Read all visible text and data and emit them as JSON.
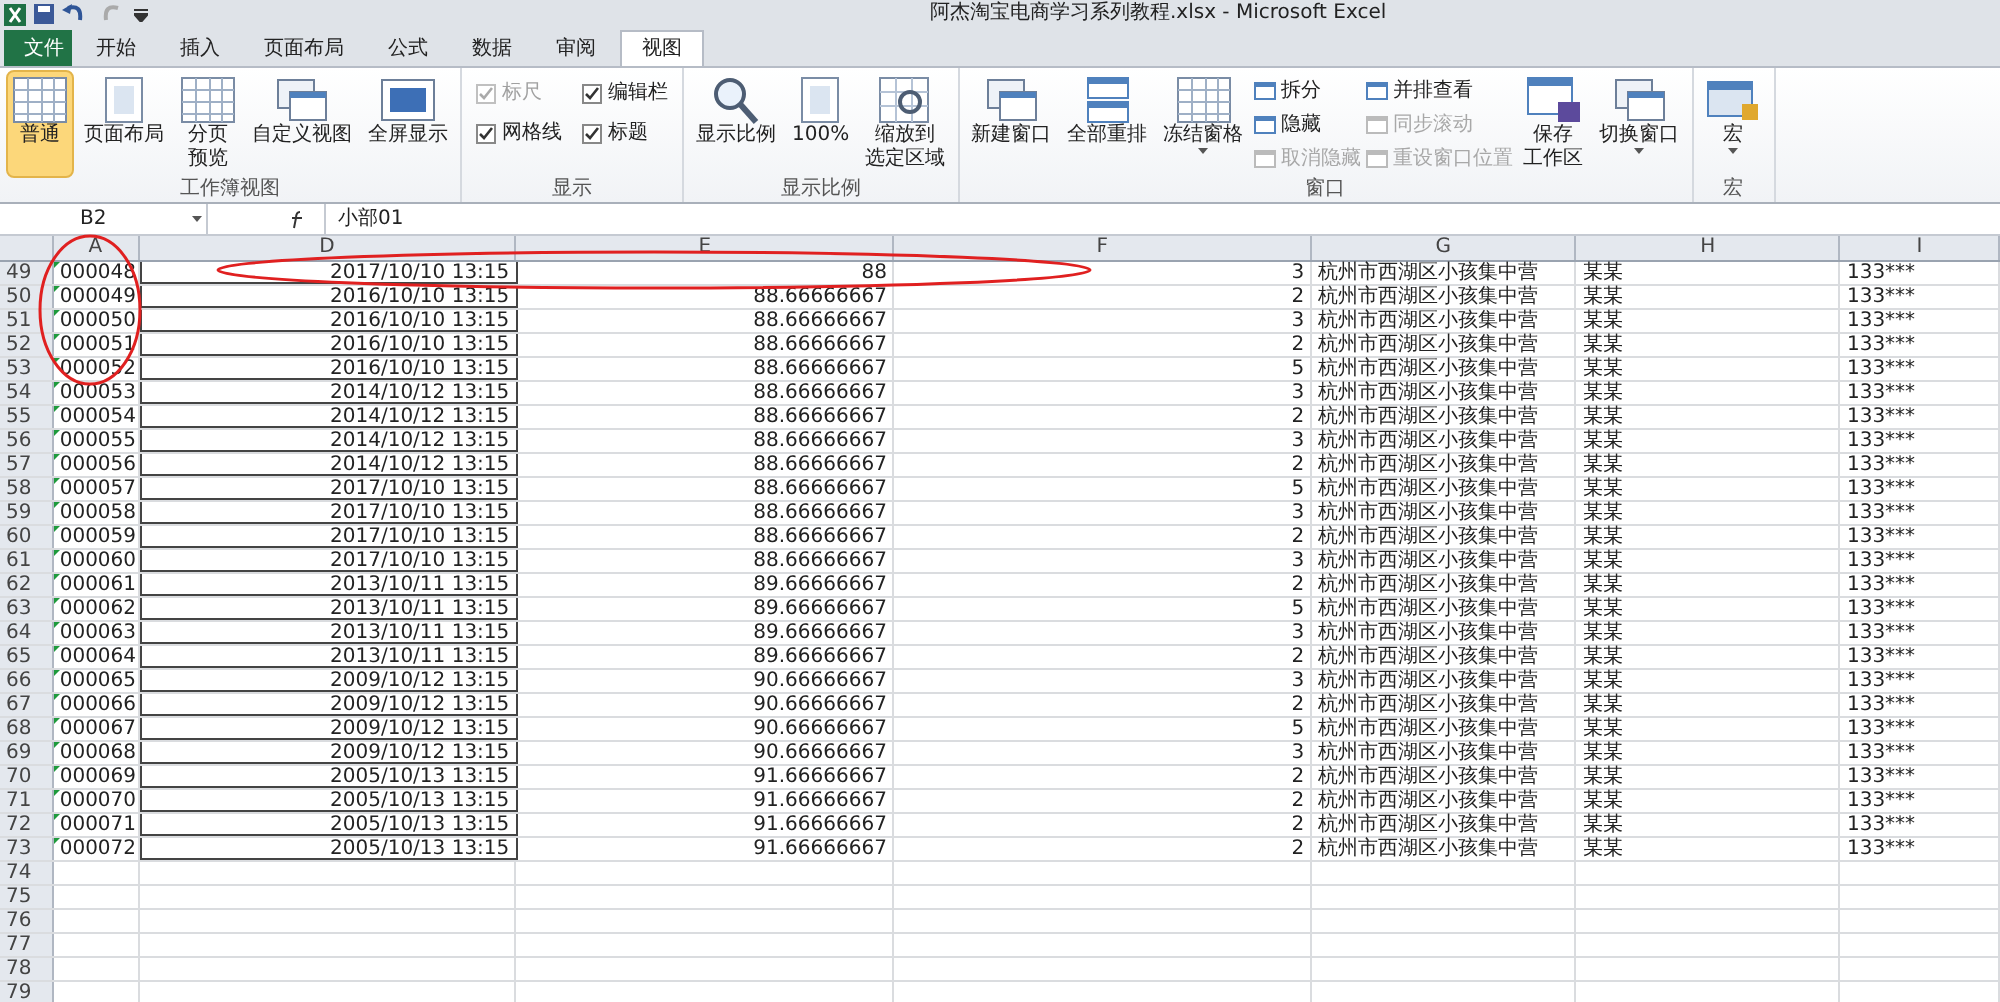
{
  "window": {
    "title": "阿杰淘宝电商学习系列教程.xlsx - Microsoft Excel"
  },
  "tabs": [
    {
      "label": "文件",
      "kind": "file",
      "selected": false
    },
    {
      "label": "开始",
      "kind": "tab",
      "selected": false
    },
    {
      "label": "插入",
      "kind": "tab",
      "selected": false
    },
    {
      "label": "页面布局",
      "kind": "tab",
      "selected": false
    },
    {
      "label": "公式",
      "kind": "tab",
      "selected": false
    },
    {
      "label": "数据",
      "kind": "tab",
      "selected": false
    },
    {
      "label": "审阅",
      "kind": "tab",
      "selected": false
    },
    {
      "label": "视图",
      "kind": "tab",
      "selected": true
    }
  ],
  "ribbon_groups": [
    {
      "label": "工作簿视图",
      "items": [
        {
          "kind": "large",
          "lines": [
            "普通"
          ],
          "selected": true
        },
        {
          "kind": "large",
          "lines": [
            "页面布局"
          ],
          "selected": false
        },
        {
          "kind": "large",
          "lines": [
            "分页",
            "预览"
          ],
          "selected": false
        },
        {
          "kind": "large",
          "lines": [
            "自定义视图"
          ],
          "selected": false
        },
        {
          "kind": "large",
          "lines": [
            "全屏显示"
          ],
          "selected": false
        }
      ]
    },
    {
      "label": "显示",
      "items": [
        {
          "kind": "checks",
          "checks": [
            {
              "label": "标尺",
              "checked": true,
              "disabled": true
            },
            {
              "label": "网格线",
              "checked": true,
              "disabled": false
            }
          ]
        },
        {
          "kind": "checks",
          "checks": [
            {
              "label": "编辑栏",
              "checked": true,
              "disabled": false
            },
            {
              "label": "标题",
              "checked": true,
              "disabled": false
            }
          ]
        }
      ]
    },
    {
      "label": "显示比例",
      "items": [
        {
          "kind": "large",
          "lines": [
            "显示比例"
          ],
          "selected": false
        },
        {
          "kind": "large",
          "lines": [
            "100%"
          ],
          "selected": false
        },
        {
          "kind": "large",
          "lines": [
            "缩放到",
            "选定区域"
          ],
          "selected": false
        }
      ]
    },
    {
      "label": "窗口",
      "items": [
        {
          "kind": "large",
          "lines": [
            "新建窗口"
          ],
          "selected": false
        },
        {
          "kind": "large",
          "lines": [
            "全部重排"
          ],
          "selected": false
        },
        {
          "kind": "large",
          "lines": [
            "冻结窗格"
          ],
          "dropdown": true,
          "selected": false
        },
        {
          "kind": "smalls",
          "smalls": [
            {
              "label": "拆分",
              "disabled": false
            },
            {
              "label": "隐藏",
              "disabled": false
            },
            {
              "label": "取消隐藏",
              "disabled": true
            }
          ]
        },
        {
          "kind": "smalls",
          "smalls": [
            {
              "label": "并排查看",
              "disabled": false
            },
            {
              "label": "同步滚动",
              "disabled": true
            },
            {
              "label": "重设窗口位置",
              "disabled": true
            }
          ]
        },
        {
          "kind": "large",
          "lines": [
            "保存",
            "工作区"
          ],
          "selected": false
        },
        {
          "kind": "large",
          "lines": [
            "切换窗口"
          ],
          "dropdown": true,
          "selected": false
        }
      ]
    },
    {
      "label": "宏",
      "items": [
        {
          "kind": "large",
          "lines": [
            "宏"
          ],
          "dropdown": true,
          "selected": false
        }
      ]
    }
  ],
  "formula_bar": {
    "name_box": "B2",
    "formula": "小部01"
  },
  "table": {
    "columns": [
      "A",
      "D",
      "E",
      "F",
      "G",
      "H",
      "I"
    ],
    "rows": [
      {
        "row": "49",
        "cells": [
          "000048",
          "2017/10/10 13:15",
          "88",
          "3",
          "杭州市西湖区小孩集中营",
          "某某",
          "133***"
        ]
      },
      {
        "row": "50",
        "cells": [
          "000049",
          "2016/10/10 13:15",
          "88.66666667",
          "2",
          "杭州市西湖区小孩集中营",
          "某某",
          "133***"
        ]
      },
      {
        "row": "51",
        "cells": [
          "000050",
          "2016/10/10 13:15",
          "88.66666667",
          "3",
          "杭州市西湖区小孩集中营",
          "某某",
          "133***"
        ]
      },
      {
        "row": "52",
        "cells": [
          "000051",
          "2016/10/10 13:15",
          "88.66666667",
          "2",
          "杭州市西湖区小孩集中营",
          "某某",
          "133***"
        ]
      },
      {
        "row": "53",
        "cells": [
          "000052",
          "2016/10/10 13:15",
          "88.66666667",
          "5",
          "杭州市西湖区小孩集中营",
          "某某",
          "133***"
        ]
      },
      {
        "row": "54",
        "cells": [
          "000053",
          "2014/10/12 13:15",
          "88.66666667",
          "3",
          "杭州市西湖区小孩集中营",
          "某某",
          "133***"
        ]
      },
      {
        "row": "55",
        "cells": [
          "000054",
          "2014/10/12 13:15",
          "88.66666667",
          "2",
          "杭州市西湖区小孩集中营",
          "某某",
          "133***"
        ]
      },
      {
        "row": "56",
        "cells": [
          "000055",
          "2014/10/12 13:15",
          "88.66666667",
          "3",
          "杭州市西湖区小孩集中营",
          "某某",
          "133***"
        ]
      },
      {
        "row": "57",
        "cells": [
          "000056",
          "2014/10/12 13:15",
          "88.66666667",
          "2",
          "杭州市西湖区小孩集中营",
          "某某",
          "133***"
        ]
      },
      {
        "row": "58",
        "cells": [
          "000057",
          "2017/10/10 13:15",
          "88.66666667",
          "5",
          "杭州市西湖区小孩集中营",
          "某某",
          "133***"
        ]
      },
      {
        "row": "59",
        "cells": [
          "000058",
          "2017/10/10 13:15",
          "88.66666667",
          "3",
          "杭州市西湖区小孩集中营",
          "某某",
          "133***"
        ]
      },
      {
        "row": "60",
        "cells": [
          "000059",
          "2017/10/10 13:15",
          "88.66666667",
          "2",
          "杭州市西湖区小孩集中营",
          "某某",
          "133***"
        ]
      },
      {
        "row": "61",
        "cells": [
          "000060",
          "2017/10/10 13:15",
          "88.66666667",
          "3",
          "杭州市西湖区小孩集中营",
          "某某",
          "133***"
        ]
      },
      {
        "row": "62",
        "cells": [
          "000061",
          "2013/10/11 13:15",
          "89.66666667",
          "2",
          "杭州市西湖区小孩集中营",
          "某某",
          "133***"
        ]
      },
      {
        "row": "63",
        "cells": [
          "000062",
          "2013/10/11 13:15",
          "89.66666667",
          "5",
          "杭州市西湖区小孩集中营",
          "某某",
          "133***"
        ]
      },
      {
        "row": "64",
        "cells": [
          "000063",
          "2013/10/11 13:15",
          "89.66666667",
          "3",
          "杭州市西湖区小孩集中营",
          "某某",
          "133***"
        ]
      },
      {
        "row": "65",
        "cells": [
          "000064",
          "2013/10/11 13:15",
          "89.66666667",
          "2",
          "杭州市西湖区小孩集中营",
          "某某",
          "133***"
        ]
      },
      {
        "row": "66",
        "cells": [
          "000065",
          "2009/10/12 13:15",
          "90.66666667",
          "3",
          "杭州市西湖区小孩集中营",
          "某某",
          "133***"
        ]
      },
      {
        "row": "67",
        "cells": [
          "000066",
          "2009/10/12 13:15",
          "90.66666667",
          "2",
          "杭州市西湖区小孩集中营",
          "某某",
          "133***"
        ]
      },
      {
        "row": "68",
        "cells": [
          "000067",
          "2009/10/12 13:15",
          "90.66666667",
          "5",
          "杭州市西湖区小孩集中营",
          "某某",
          "133***"
        ]
      },
      {
        "row": "69",
        "cells": [
          "000068",
          "2009/10/12 13:15",
          "90.66666667",
          "3",
          "杭州市西湖区小孩集中营",
          "某某",
          "133***"
        ]
      },
      {
        "row": "70",
        "cells": [
          "000069",
          "2005/10/13 13:15",
          "91.66666667",
          "2",
          "杭州市西湖区小孩集中营",
          "某某",
          "133***"
        ]
      },
      {
        "row": "71",
        "cells": [
          "000070",
          "2005/10/13 13:15",
          "91.66666667",
          "2",
          "杭州市西湖区小孩集中营",
          "某某",
          "133***"
        ]
      },
      {
        "row": "72",
        "cells": [
          "000071",
          "2005/10/13 13:15",
          "91.66666667",
          "2",
          "杭州市西湖区小孩集中营",
          "某某",
          "133***"
        ]
      },
      {
        "row": "73",
        "cells": [
          "000072",
          "2005/10/13 13:15",
          "91.66666667",
          "2",
          "杭州市西湖区小孩集中营",
          "某某",
          "133***"
        ]
      },
      {
        "row": "74"
      },
      {
        "row": "75"
      },
      {
        "row": "76"
      },
      {
        "row": "77"
      },
      {
        "row": "78"
      },
      {
        "row": "79"
      }
    ]
  }
}
